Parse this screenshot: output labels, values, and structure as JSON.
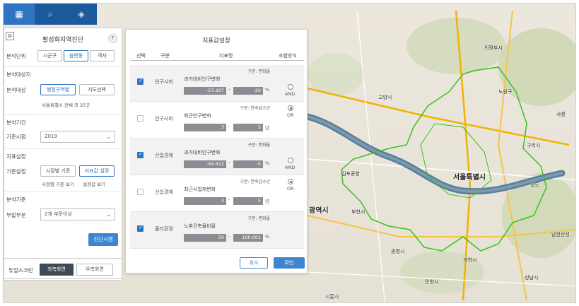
{
  "colors": {
    "accent": "#2f74c0",
    "toolbar": "#1d5a9c",
    "boundary": "#39c21a",
    "river": "#5b7e98"
  },
  "top_tabs": [
    {
      "icon": "grid-icon"
    },
    {
      "icon": "search-icon"
    },
    {
      "icon": "layers-icon"
    }
  ],
  "left_panel": {
    "title": "활성화지역진단",
    "help": "?",
    "unit_label": "분석단위",
    "unit_options": [
      "시군구",
      "읍면동",
      "격자"
    ],
    "target_section": "분석대상지",
    "target_label": "분석대상",
    "target_options": [
      "행정구역별",
      "지도선택"
    ],
    "target_note": "서울특별시 전체 외 25곳",
    "period_section": "분석기간",
    "base_year_label": "기준시점",
    "base_year_value": "2019",
    "indicator_section": "지표설정",
    "criteria_label": "기준설정",
    "criteria_options": [
      "시점별 기준",
      "지표값 설정"
    ],
    "criteria_links": [
      "시점별 기준 보기",
      "설정값 보기"
    ],
    "analysis_section": "분석기준",
    "sector_label": "부합부문",
    "sector_value": "2개 부문이상",
    "run_button": "진단시행"
  },
  "dual_screen": {
    "label": "듀얼스크린",
    "left": "좌측화면",
    "right": "우측화면"
  },
  "dialog": {
    "title": "지표값설정",
    "columns": [
      "선택",
      "구분",
      "지표명",
      "조합방식"
    ],
    "rows": [
      {
        "checked": true,
        "category": "인구사회",
        "indicator": "과거대비인구변화",
        "unit": "구분: 변화율",
        "min": "-57.267",
        "max": "-20",
        "suffix": "%"
      },
      {
        "checked": false,
        "category": "인구사회",
        "indicator": "최근인구변화",
        "unit": "구분: 연속감소년",
        "min": "3",
        "max": "5",
        "suffix": "년"
      },
      {
        "checked": true,
        "category": "산업경제",
        "indicator": "과거대비인구변화",
        "unit": "구분: 변화율",
        "min": "-94.612",
        "max": "-5",
        "suffix": "%"
      },
      {
        "checked": false,
        "category": "산업경제",
        "indicator": "최근사업체변화",
        "unit": "구분: 연속감소년",
        "min": "3",
        "max": "5",
        "suffix": "년"
      },
      {
        "checked": true,
        "category": "물리환경",
        "indicator": "노후건축물비율",
        "unit": "구분: 변화율",
        "min": "50",
        "max": "100.001",
        "suffix": "%"
      }
    ],
    "combine_groups": [
      {
        "and": "AND",
        "or": "OR",
        "selected": "OR"
      },
      {
        "and": "AND",
        "or": "OR",
        "selected": "OR"
      }
    ],
    "cancel": "취소",
    "ok": "확인"
  },
  "map_labels": [
    {
      "text": "의정부시",
      "big": false
    },
    {
      "text": "고양시",
      "big": false
    },
    {
      "text": "구리시",
      "big": false
    },
    {
      "text": "서울특별시",
      "big": true
    },
    {
      "text": "광역시",
      "big": true
    },
    {
      "text": "부천시",
      "big": false
    },
    {
      "text": "광명시",
      "big": false
    },
    {
      "text": "과천시",
      "big": false
    },
    {
      "text": "안양시",
      "big": false
    },
    {
      "text": "성남시",
      "big": false
    },
    {
      "text": "시흥시",
      "big": false
    },
    {
      "text": "김포공항",
      "big": false
    },
    {
      "text": "상도",
      "big": false
    },
    {
      "text": "노원구",
      "big": false
    },
    {
      "text": "사릉",
      "big": false
    },
    {
      "text": "남한산성",
      "big": false
    }
  ]
}
